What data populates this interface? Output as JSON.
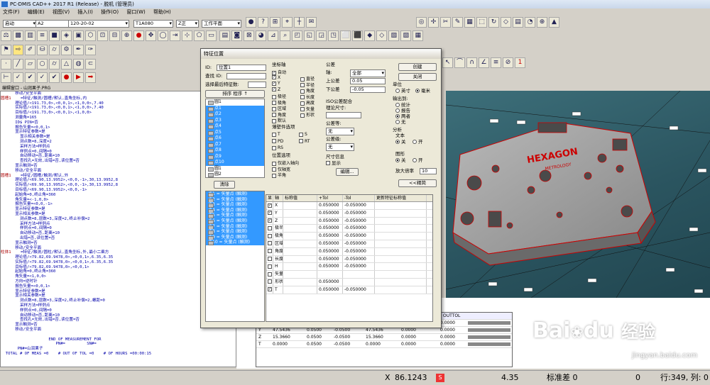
{
  "window": {
    "title": "PC-DMIS CAD++ 2017 R1 (Release) - 脱机 (管理员)"
  },
  "menu": [
    "文件(F)",
    "编辑(E)",
    "视图(V)",
    "插入(I)",
    "操作(O)",
    "窗口(W)",
    "帮助(H)"
  ],
  "combos": {
    "mode": "启动",
    "probe_file": "A2",
    "tip": "120-20-02",
    "angle": "T1A080",
    "view": "Z正",
    "plane": "工作平面"
  },
  "editor": {
    "title": "编辑窗口 - 山润果子.PRG",
    "lines": [
      {
        "label": "",
        "text": "      移动/安全平面"
      },
      {
        "label": "圆槽1",
        "text": "    =特征/触测/圆槽/默认,直角坐标,内"
      },
      {
        "label": "",
        "text": "      理论值/<191.73,0>,<0,0,1>,<1,0,0>,7.40"
      },
      {
        "label": "",
        "text": "      实际值/<191.73,0>,<0,0,1>,<1,0,0>,7.40"
      },
      {
        "label": "",
        "text": "      目标值/<191.73,0>,<0,0,1>,<1,0,0>"
      },
      {
        "label": "",
        "text": "      测量角=165"
      },
      {
        "label": "",
        "text": "      ID$ PIN=否"
      },
      {
        "label": "",
        "text": "      报告矢量=<0,0,1>"
      },
      {
        "label": "",
        "text": "      显示特征参数=是"
      },
      {
        "label": "",
        "text": "        显示相关参数=是"
      },
      {
        "label": "",
        "text": "        测点数=8,深度=2"
      },
      {
        "label": "",
        "text": "        采样方法=样例点"
      },
      {
        "label": "",
        "text": "        样例点=0,间隔=0"
      },
      {
        "label": "",
        "text": "        自动移动=否,距离=10"
      },
      {
        "label": "",
        "text": "        查找孔=无效,出错=否,读位置=否"
      },
      {
        "label": "",
        "text": "      显示触测=否"
      },
      {
        "label": "",
        "text": "      移动/安全平面"
      },
      {
        "label": "圆槽1",
        "text": "    =特征/圆槽/触测/默认,外"
      },
      {
        "label": "",
        "text": "      理论值/<69.90,13.9952>,<0,0,-1>,30,13.9952,8"
      },
      {
        "label": "",
        "text": "      实际值/<69.90,13.9952>,<0,0,-1>,30,13.9952,8"
      },
      {
        "label": "",
        "text": "      目标值/<69.90,13.9952>,<0,0,-1>"
      },
      {
        "label": "",
        "text": "      起始角=0,终止角=360"
      },
      {
        "label": "",
        "text": "      角矢量=<-1,0,0>"
      },
      {
        "label": "",
        "text": "      报告矢量=<0,0,-1>"
      },
      {
        "label": "",
        "text": "      显示特征参数=是"
      },
      {
        "label": "",
        "text": "      显示相关参数=是"
      },
      {
        "label": "",
        "text": "        测点数=8,层数=3,深度=2,终止补偿=2"
      },
      {
        "label": "",
        "text": "        采样方法=样例点"
      },
      {
        "label": "",
        "text": "        样例点=0,间隔=0"
      },
      {
        "label": "",
        "text": "        自动移动=否,距离=10"
      },
      {
        "label": "",
        "text": "        出错=否,读位置=否"
      },
      {
        "label": "",
        "text": "      显示触测=否"
      },
      {
        "label": "",
        "text": "      移动/安全平面"
      },
      {
        "label": "柱体1",
        "text": "    =特征/触测/圆柱/默认,直角坐标,外,最小二乘方"
      },
      {
        "label": "",
        "text": "      理论值/<79.82,69.9478,0>,<0,0,1>,6.35,6.35"
      },
      {
        "label": "",
        "text": "      实际值/<79.82,69.9478,0>,<0,0,1>,6.35,6.35"
      },
      {
        "label": "",
        "text": "      目标值/<79.82,69.9478,0>,<0,0,1>"
      },
      {
        "label": "",
        "text": "      起始角=0,终止角=360"
      },
      {
        "label": "",
        "text": "      角矢量=<1,0,0>"
      },
      {
        "label": "",
        "text": "      方向=逆时针"
      },
      {
        "label": "",
        "text": "      报告矢量=<0,0,1>"
      },
      {
        "label": "",
        "text": "      显示特征参数=是"
      },
      {
        "label": "",
        "text": "      显示相关参数=是"
      },
      {
        "label": "",
        "text": "        测点数=8,层数=3,深度=2,终止补偿=2,螺距=0"
      },
      {
        "label": "",
        "text": "        采样方法=样例点"
      },
      {
        "label": "",
        "text": "        样例点=0,间隔=0"
      },
      {
        "label": "",
        "text": "        自动移动=否,距离=10"
      },
      {
        "label": "",
        "text": "        查找孔=无效,出错=否,读位置=否"
      },
      {
        "label": "",
        "text": "      显示触测=否"
      },
      {
        "label": "",
        "text": "      移动/安全平面"
      },
      {
        "label": "",
        "text": ""
      },
      {
        "label": "",
        "text": "                    END OF MEASUREMENT FOR"
      },
      {
        "label": "",
        "text": "                       PN#=         SN#="
      },
      {
        "label": "",
        "text": "       PN#=山润果子"
      },
      {
        "label": "",
        "text": "  TOTAL # OF MEAS =0    # OUT OF TOL =0    # OF HOURS =00:00:15"
      }
    ]
  },
  "dialog": {
    "title": "特征位置",
    "id_label": "ID:",
    "id_value": "位置1",
    "find_id_label": "查找 ID:",
    "select_after_label": "选择最后特征数:",
    "sort_label": "排序  程序  ↑",
    "features": [
      {
        "name": "圆1",
        "sel": false
      },
      {
        "name": "点1",
        "sel": true
      },
      {
        "name": "点2",
        "sel": true
      },
      {
        "name": "点3",
        "sel": true
      },
      {
        "name": "点4",
        "sel": true
      },
      {
        "name": "点5",
        "sel": true
      },
      {
        "name": "点6",
        "sel": true
      },
      {
        "name": "点7",
        "sel": true
      },
      {
        "name": "点8",
        "sel": true
      },
      {
        "name": "点9",
        "sel": true
      },
      {
        "name": "点10",
        "sel": true
      },
      {
        "name": "圆1",
        "sel": false
      },
      {
        "name": "圆2",
        "sel": false
      },
      {
        "name": "圆3",
        "sel": false
      },
      {
        "name": "圆4",
        "sel": false
      }
    ],
    "clear_label": "清除",
    "selected_features": [
      "点1 = 矢量点 (触测)",
      "点2 = 矢量点 (触测)",
      "点3 = 矢量点 (触测)",
      "点4 = 矢量点 (触测)",
      "点5 = 矢量点 (触测)",
      "点6 = 矢量点 (触测)",
      "点7 = 矢量点 (触测)",
      "点8 = 矢量点 (触测)",
      "点9 = 矢量点 (触测)",
      "点10 = 矢量点 (触测)"
    ],
    "axes_group": "坐标轴",
    "axes": [
      {
        "name": "自动",
        "checked": true
      },
      {
        "name": "X",
        "checked": true
      },
      {
        "name": "Y",
        "checked": true
      },
      {
        "name": "Z",
        "checked": true
      },
      {
        "name": "极径",
        "checked": false
      },
      {
        "name": "极角",
        "checked": false
      },
      {
        "name": "区域",
        "checked": false
      },
      {
        "name": "角度",
        "checked": false
      },
      {
        "name": "默认",
        "checked": false
      }
    ],
    "axes_right": [
      "直径",
      "半径",
      "角度",
      "长度",
      "高度",
      "矢量",
      "形状"
    ],
    "thin_group": "薄壁件选项",
    "thin": [
      "T",
      "S",
      "PD",
      "RT",
      "RS"
    ],
    "position_group": "位置选项",
    "position": [
      "仅嵌入轴向",
      "仅轴宽",
      "半角"
    ],
    "tol_group": "公差",
    "axis_label": "轴:",
    "axis_value": "全部",
    "upper_label": "上公差",
    "upper_value": "0.05",
    "lower_label": "下公差",
    "lower_value": "-0.05",
    "iso_label": "ISO公差配合",
    "iso_size_label": "理论尺寸:",
    "tol_grade_label": "公差等:",
    "tol_grade_value": "无",
    "tol_class_label": "公差级:",
    "tol_class_value": "无",
    "size_info_label": "尺寸信息",
    "show_label": "显示",
    "edit_label": "编辑...",
    "create_label": "创建",
    "close_label": "关闭",
    "unit_label": "单位",
    "unit_inch": "英寸",
    "unit_mm": "毫米",
    "output_label": "输出到:",
    "out_stats": "统计",
    "out_report": "报告",
    "out_both": "两者",
    "out_none": "无",
    "analysis_label": "分析",
    "text_label": "文本",
    "off_label": "关",
    "on_label": "开",
    "graph_label": "图形",
    "magnify_label": "放大倍率",
    "magnify_value": "10",
    "advanced_label": "<<精简",
    "grid_headers": [
      "显",
      "轴",
      "标称值",
      "+Tol",
      "-Tol",
      "更新特征标称值"
    ],
    "grid_rows": [
      {
        "chk": true,
        "axis": "X",
        "nom": "",
        "plus": "0.050000",
        "minus": "-0.050000"
      },
      {
        "chk": true,
        "axis": "Y",
        "nom": "",
        "plus": "0.050000",
        "minus": "-0.050000"
      },
      {
        "chk": true,
        "axis": "Z",
        "nom": "",
        "plus": "0.050000",
        "minus": "-0.050000"
      },
      {
        "chk": false,
        "axis": "极半径",
        "nom": "",
        "plus": "0.050000",
        "minus": "-0.050000"
      },
      {
        "chk": false,
        "axis": "极角",
        "nom": "",
        "plus": "0.050000",
        "minus": "-0.050000"
      },
      {
        "chk": false,
        "axis": "区域",
        "nom": "",
        "plus": "0.050000",
        "minus": "-0.050000"
      },
      {
        "chk": false,
        "axis": "角度",
        "nom": "",
        "plus": "0.050000",
        "minus": "-0.050000"
      },
      {
        "chk": false,
        "axis": "长度",
        "nom": "",
        "plus": "0.050000",
        "minus": "-0.050000"
      },
      {
        "chk": false,
        "axis": "H",
        "nom": "",
        "plus": "0.050000",
        "minus": "-0.050000"
      },
      {
        "chk": false,
        "axis": "矢量",
        "nom": "",
        "plus": "",
        "minus": ""
      },
      {
        "chk": false,
        "axis": "形状",
        "nom": "",
        "plus": "0.050000",
        "minus": ""
      },
      {
        "chk": true,
        "axis": "T",
        "nom": "",
        "plus": "0.050000",
        "minus": "-0.050000"
      }
    ]
  },
  "result_table": {
    "header_tail": "OUTTOL",
    "rows": [
      {
        "ax": "X",
        "a": "1.4642",
        "b": "0.0500",
        "c": "-0.0500",
        "d": "1.4642",
        "e": "0.0000",
        "f": "0.0000"
      },
      {
        "ax": "Y",
        "a": "47.5436",
        "b": "0.0500",
        "c": "-0.0500",
        "d": "47.5436",
        "e": "0.0000",
        "f": "0.0000"
      },
      {
        "ax": "Z",
        "a": "15.3660",
        "b": "0.0500",
        "c": "-0.0500",
        "d": "15.3660",
        "e": "0.0000",
        "f": "0.0000"
      },
      {
        "ax": "T",
        "a": "0.0000",
        "b": "0.0500",
        "c": "-0.0500",
        "d": "0.0000",
        "e": "0.0000",
        "f": "0.0000"
      }
    ]
  },
  "status": {
    "x_label": "X",
    "x_value": "86.1243",
    "z_value": "4.35",
    "std_label": "标准差 0",
    "count": "0",
    "rowcol": "行:349, 列: 0"
  },
  "model": {
    "brand": "HEXAGON",
    "brand_sub": "METROLOGY"
  },
  "watermark": {
    "main": "Bai",
    "main2": "du",
    "cn": "经验",
    "url": "jingyan.baidu.com"
  }
}
